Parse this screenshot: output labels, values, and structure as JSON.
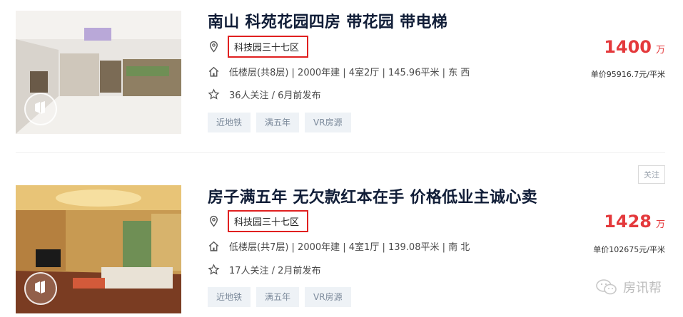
{
  "listings": [
    {
      "title": "南山 科苑花园四房 带花园 带电梯",
      "community": "科技园三十七区",
      "info": "低楼层(共8层) | 2000年建 | 4室2厅 | 145.96平米 | 东 西",
      "follow": "36人关注 / 6月前发布",
      "tags": [
        "近地铁",
        "满五年",
        "VR房源"
      ],
      "price": "1400",
      "price_unit": "万",
      "unit_price": "单价95916.7元/平米",
      "icons": [
        "vr-icon",
        "location-pin-icon",
        "house-icon",
        "star-icon"
      ]
    },
    {
      "title": "房子满五年 无欠款红本在手 价格低业主诚心卖",
      "community": "科技园三十七区",
      "info": "低楼层(共7层) | 2000年建 | 4室1厅 | 139.08平米 | 南 北",
      "follow": "17人关注 / 2月前发布",
      "tags": [
        "近地铁",
        "满五年",
        "VR房源"
      ],
      "price": "1428",
      "price_unit": "万",
      "unit_price": "单价102675元/平米",
      "follow_button": "关注",
      "icons": [
        "vr-icon",
        "location-pin-icon",
        "house-icon",
        "star-icon"
      ]
    }
  ],
  "watermark": {
    "text": "房讯帮",
    "icon": "wechat-icon"
  },
  "colors": {
    "price": "#e4393c",
    "highlight_box": "#e02020",
    "title": "#101d37",
    "tag_bg": "#eef2f6"
  }
}
